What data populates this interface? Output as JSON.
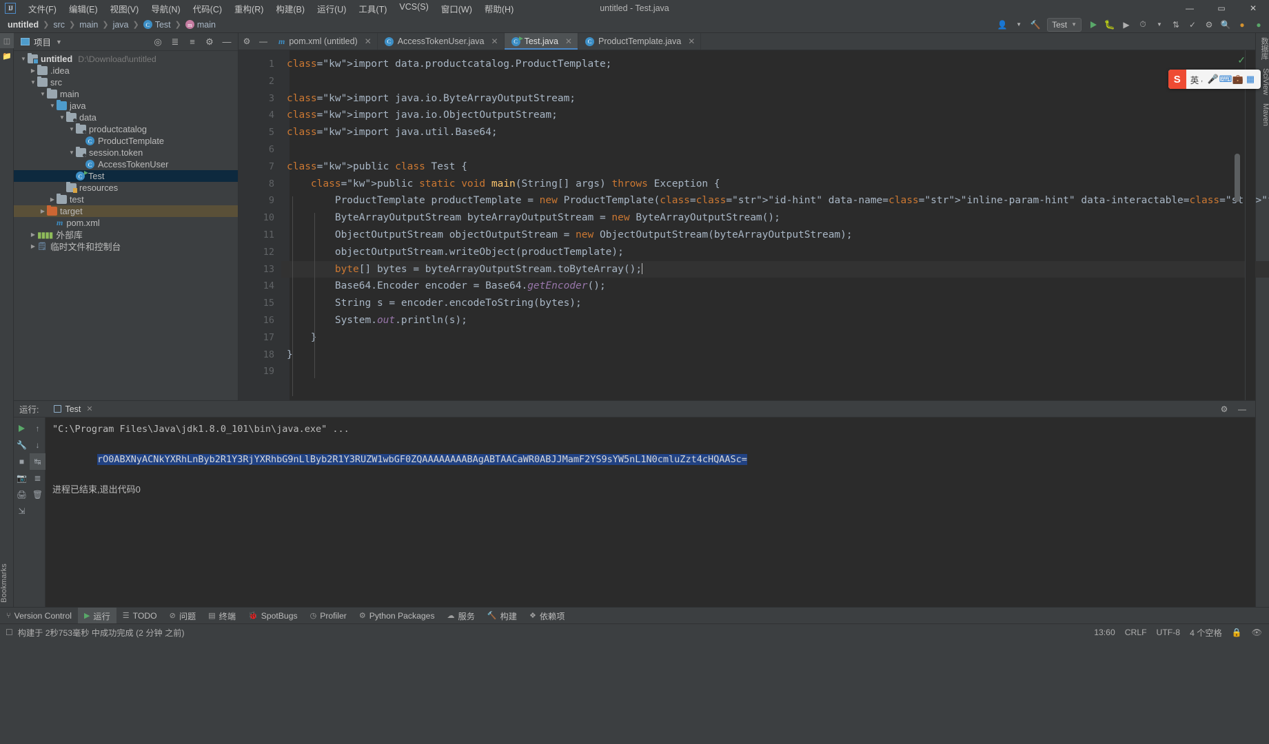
{
  "window": {
    "title": "untitled - Test.java",
    "logo": "IJ",
    "controls": {
      "minimize": "—",
      "maximize": "▭",
      "close": "✕"
    }
  },
  "menu": [
    "文件(F)",
    "编辑(E)",
    "视图(V)",
    "导航(N)",
    "代码(C)",
    "重构(R)",
    "构建(B)",
    "运行(U)",
    "工具(T)",
    "VCS(S)",
    "窗口(W)",
    "帮助(H)"
  ],
  "breadcrumbs": [
    {
      "label": "untitled",
      "bold": true
    },
    {
      "label": "src",
      "bold": false
    },
    {
      "label": "main",
      "bold": false
    },
    {
      "label": "java",
      "bold": false
    },
    {
      "label": "Test",
      "bold": false,
      "icon": "class-icon"
    },
    {
      "label": "main",
      "bold": false,
      "icon": "method-icon"
    }
  ],
  "navbar_right": {
    "run_config": "Test",
    "icons": [
      "user-icon",
      "hammer-icon",
      "run-icon",
      "debug-icon",
      "coverage-icon",
      "profiler-icon",
      "chevron-down-icon",
      "git-update-icon",
      "settings-icon",
      "search-icon",
      "notifications-icon",
      "account-icon"
    ]
  },
  "project_panel": {
    "title": "项目",
    "tools": [
      "locate-icon",
      "expand-all-icon",
      "collapse-all-icon",
      "gear-icon",
      "hide-icon"
    ],
    "tree": [
      {
        "depth": 0,
        "arrow": "down",
        "icon": "module-folder",
        "label": "untitled",
        "bold": true,
        "path": "D:\\Download\\untitled"
      },
      {
        "depth": 1,
        "arrow": "right",
        "icon": "folder",
        "label": ".idea"
      },
      {
        "depth": 1,
        "arrow": "down",
        "icon": "folder",
        "label": "src"
      },
      {
        "depth": 2,
        "arrow": "down",
        "icon": "folder",
        "label": "main"
      },
      {
        "depth": 3,
        "arrow": "down",
        "icon": "source-folder",
        "label": "java"
      },
      {
        "depth": 4,
        "arrow": "down",
        "icon": "package",
        "label": "data"
      },
      {
        "depth": 5,
        "arrow": "down",
        "icon": "package",
        "label": "productcatalog"
      },
      {
        "depth": 6,
        "arrow": "none",
        "icon": "class-icon",
        "label": "ProductTemplate"
      },
      {
        "depth": 5,
        "arrow": "down",
        "icon": "package",
        "label": "session.token"
      },
      {
        "depth": 6,
        "arrow": "none",
        "icon": "class-icon",
        "label": "AccessTokenUser"
      },
      {
        "depth": 5,
        "arrow": "none",
        "icon": "runnable-class",
        "label": "Test",
        "selected": true
      },
      {
        "depth": 4,
        "arrow": "none",
        "icon": "resource-folder",
        "label": "resources"
      },
      {
        "depth": 3,
        "arrow": "right",
        "icon": "folder",
        "label": "test"
      },
      {
        "depth": 2,
        "arrow": "right",
        "icon": "target-folder",
        "label": "target",
        "highlighted": true
      },
      {
        "depth": 3,
        "arrow": "none",
        "icon": "maven-icon",
        "label": "pom.xml"
      },
      {
        "depth": 1,
        "arrow": "right",
        "icon": "library-icon",
        "label": "外部库"
      },
      {
        "depth": 1,
        "arrow": "right",
        "icon": "scratch-icon",
        "label": "临时文件和控制台"
      }
    ]
  },
  "editor": {
    "tabs": [
      {
        "label": "pom.xml (untitled)",
        "icon": "maven-icon",
        "active": false
      },
      {
        "label": "AccessTokenUser.java",
        "icon": "class-icon",
        "active": false
      },
      {
        "label": "Test.java",
        "icon": "runnable-class-icon",
        "active": true
      },
      {
        "label": "ProductTemplate.java",
        "icon": "class-icon",
        "active": false
      }
    ],
    "lines": [
      {
        "n": 1,
        "runmark": false,
        "text": "import data.productcatalog.ProductTemplate;"
      },
      {
        "n": 2,
        "runmark": false,
        "text": ""
      },
      {
        "n": 3,
        "runmark": false,
        "text": "import java.io.ByteArrayOutputStream;"
      },
      {
        "n": 4,
        "runmark": false,
        "text": "import java.io.ObjectOutputStream;"
      },
      {
        "n": 5,
        "runmark": false,
        "text": "import java.util.Base64;"
      },
      {
        "n": 6,
        "runmark": false,
        "text": ""
      },
      {
        "n": 7,
        "runmark": true,
        "text": "public class Test {"
      },
      {
        "n": 8,
        "runmark": true,
        "text": "    public static void main(String[] args) throws Exception {"
      },
      {
        "n": 9,
        "runmark": false,
        "text": "        ProductTemplate productTemplate = new ProductTemplate( id: \"'\");"
      },
      {
        "n": 10,
        "runmark": false,
        "text": "        ByteArrayOutputStream byteArrayOutputStream = new ByteArrayOutputStream();"
      },
      {
        "n": 11,
        "runmark": false,
        "text": "        ObjectOutputStream objectOutputStream = new ObjectOutputStream(byteArrayOutputStream);"
      },
      {
        "n": 12,
        "runmark": false,
        "text": "        objectOutputStream.writeObject(productTemplate);"
      },
      {
        "n": 13,
        "runmark": false,
        "text": "        byte[] bytes = byteArrayOutputStream.toByteArray();",
        "highlight": true
      },
      {
        "n": 14,
        "runmark": false,
        "text": "        Base64.Encoder encoder = Base64.getEncoder();"
      },
      {
        "n": 15,
        "runmark": false,
        "text": "        String s = encoder.encodeToString(bytes);"
      },
      {
        "n": 16,
        "runmark": false,
        "text": "        System.out.println(s);"
      },
      {
        "n": 17,
        "runmark": false,
        "text": "    }"
      },
      {
        "n": 18,
        "runmark": false,
        "text": "}"
      },
      {
        "n": 19,
        "runmark": false,
        "text": ""
      }
    ],
    "inspection_status": "✓"
  },
  "run_panel": {
    "label": "运行:",
    "tab": "Test",
    "side_icons": [
      "run-icon",
      "rerun-icon",
      "scroll-up-icon",
      "scroll-down-icon",
      "stop-icon",
      "soft-wrap-icon",
      "camera-icon",
      "print-icon",
      "export-icon",
      "trash-icon",
      "up-icon"
    ],
    "header_icons": [
      "settings-icon",
      "hide-icon"
    ],
    "console": {
      "command": "\"C:\\Program Files\\Java\\jdk1.8.0_101\\bin\\java.exe\" ...",
      "output": "rO0ABXNyACNkYXRhLnByb2R1Y3RjYXRhbG9nLlByb2R1Y3RUZW1wbGF0ZQAAAAAAAABAgABTAACaWR0ABJJMamF2YS9sYW5nL1N0cmluZzt4cHQAASc=",
      "exit": "进程已结束,退出代码0"
    }
  },
  "ime": {
    "brand": "S",
    "mode": "英",
    "icons": [
      "comma-icon",
      "mic-icon",
      "keyboard-icon",
      "toolbox-icon",
      "grid-icon"
    ]
  },
  "bottom_bar": [
    {
      "label": "Version Control",
      "icon": "branch-icon",
      "active": false
    },
    {
      "label": "运行",
      "icon": "run-icon",
      "active": true
    },
    {
      "label": "TODO",
      "icon": "todo-icon",
      "active": false
    },
    {
      "label": "问题",
      "icon": "problems-icon",
      "active": false
    },
    {
      "label": "终端",
      "icon": "terminal-icon",
      "active": false
    },
    {
      "label": "SpotBugs",
      "icon": "bug-icon",
      "active": false
    },
    {
      "label": "Profiler",
      "icon": "profiler-icon",
      "active": false
    },
    {
      "label": "Python Packages",
      "icon": "python-icon",
      "active": false
    },
    {
      "label": "服务",
      "icon": "services-icon",
      "active": false
    },
    {
      "label": "构建",
      "icon": "build-icon",
      "active": false
    },
    {
      "label": "依赖项",
      "icon": "dependency-icon",
      "active": false
    }
  ],
  "status_bar": {
    "message": "构建于 2秒753毫秒 中成功完成 (2 分钟 之前)",
    "position": "13:60",
    "line_sep": "CRLF",
    "encoding": "UTF-8",
    "indent": "4 个空格"
  },
  "left_strip": {
    "icons": [
      "project-icon",
      "folder-icon"
    ],
    "vertical_label": "Bookmarks"
  },
  "right_strip": {
    "labels": [
      "数据库",
      "SciView",
      "Maven"
    ]
  }
}
